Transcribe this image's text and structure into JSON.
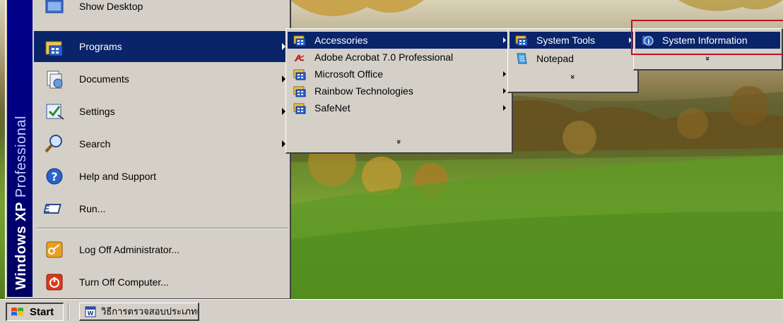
{
  "start_menu": {
    "brand": {
      "part1": "Windows XP",
      "part2": "Professional"
    },
    "items": [
      {
        "label": "Show Desktop",
        "icon": "show-desktop-icon",
        "has_submenu": false
      },
      {
        "label": "Programs",
        "icon": "programs-icon",
        "has_submenu": true
      },
      {
        "label": "Documents",
        "icon": "documents-icon",
        "has_submenu": true
      },
      {
        "label": "Settings",
        "icon": "settings-icon",
        "has_submenu": true
      },
      {
        "label": "Search",
        "icon": "search-icon",
        "has_submenu": true
      },
      {
        "label": "Help and Support",
        "icon": "help-icon",
        "has_submenu": false
      },
      {
        "label": "Run...",
        "icon": "run-icon",
        "has_submenu": false
      },
      {
        "label": "Log Off Administrator...",
        "icon": "log-off-icon",
        "has_submenu": false
      },
      {
        "label": "Turn Off Computer...",
        "icon": "power-icon",
        "has_submenu": false
      }
    ]
  },
  "programs_menu": {
    "items": [
      {
        "label": "Accessories",
        "icon": "program-group-icon",
        "has_submenu": true
      },
      {
        "label": "Adobe Acrobat 7.0 Professional",
        "icon": "acrobat-icon",
        "has_submenu": false
      },
      {
        "label": "Microsoft Office",
        "icon": "program-group-icon",
        "has_submenu": true
      },
      {
        "label": "Rainbow Technologies",
        "icon": "program-group-icon",
        "has_submenu": true
      },
      {
        "label": "SafeNet",
        "icon": "program-group-icon",
        "has_submenu": true
      }
    ],
    "more": "»"
  },
  "accessories_menu": {
    "items": [
      {
        "label": "System Tools",
        "icon": "program-group-icon",
        "has_submenu": true
      },
      {
        "label": "Notepad",
        "icon": "notepad-icon",
        "has_submenu": false
      }
    ],
    "more": "»"
  },
  "system_tools_menu": {
    "items": [
      {
        "label": "System Information",
        "icon": "system-information-icon",
        "has_submenu": false
      }
    ],
    "more": "»"
  },
  "taskbar": {
    "start_label": "Start",
    "task_label": "วิธีการตรวจสอบประเภทเค..."
  },
  "colors": {
    "menu_bg": "#d4d0c8",
    "highlight": "#0a246a",
    "brand_strip": "#000080",
    "annotation_box": "#c0102a"
  }
}
